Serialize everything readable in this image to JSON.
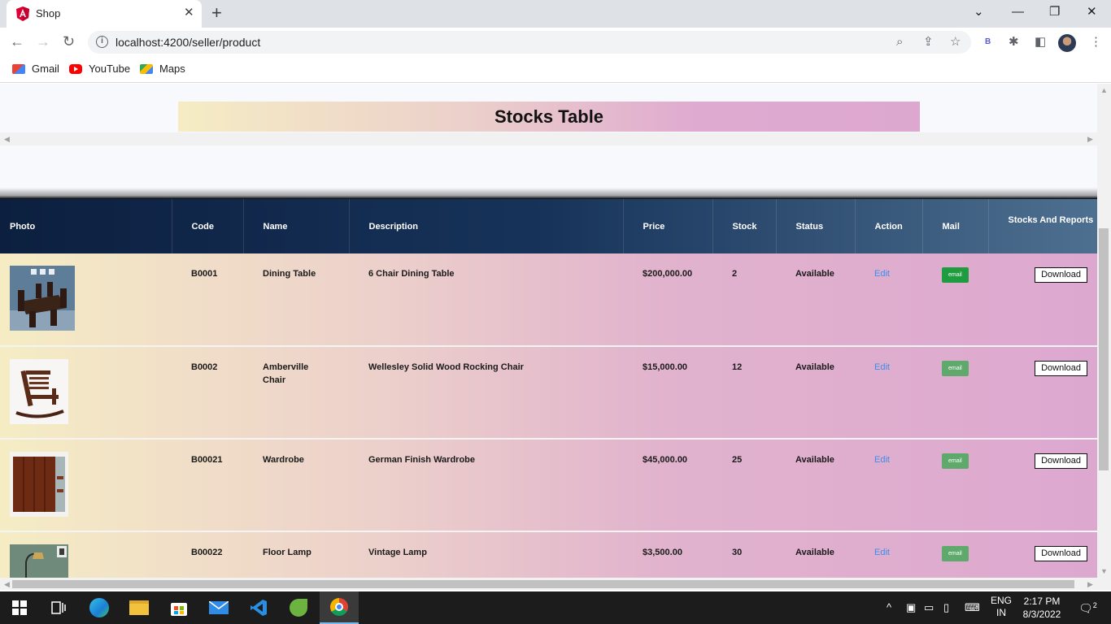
{
  "browser": {
    "tab_title": "Shop",
    "url": "localhost:4200/seller/product",
    "bookmarks": [
      {
        "label": "Gmail"
      },
      {
        "label": "YouTube"
      },
      {
        "label": "Maps"
      }
    ],
    "extension_letter": "B"
  },
  "page": {
    "title": "Stocks Table"
  },
  "table": {
    "headers": {
      "photo": "Photo",
      "code": "Code",
      "name": "Name",
      "description": "Description",
      "price": "Price",
      "stock": "Stock",
      "status": "Status",
      "action": "Action",
      "mail": "Mail",
      "stocks_reports": "Stocks And Reports"
    },
    "rows": [
      {
        "code": "B0001",
        "name": "Dining Table",
        "description": "6 Chair Dining Table",
        "price": "$200,000.00",
        "stock": "2",
        "status": "Available",
        "action": "Edit",
        "mail": "email",
        "download": "Download",
        "photo": "dining-table-photo"
      },
      {
        "code": "B0002",
        "name": "Amberville Chair",
        "description": "Wellesley Solid Wood Rocking Chair",
        "price": "$15,000.00",
        "stock": "12",
        "status": "Available",
        "action": "Edit",
        "mail": "email",
        "download": "Download",
        "photo": "rocking-chair-photo"
      },
      {
        "code": "B00021",
        "name": "Wardrobe",
        "description": "German Finish Wardrobe",
        "price": "$45,000.00",
        "stock": "25",
        "status": "Available",
        "action": "Edit",
        "mail": "email",
        "download": "Download",
        "photo": "wardrobe-photo"
      },
      {
        "code": "B00022",
        "name": "Floor Lamp",
        "description": "Vintage Lamp",
        "price": "$3,500.00",
        "stock": "30",
        "status": "Available",
        "action": "Edit",
        "mail": "email",
        "download": "Download",
        "photo": "floor-lamp-photo"
      }
    ]
  },
  "taskbar": {
    "language_top": "ENG",
    "language_bottom": "IN",
    "time": "2:17 PM",
    "date": "8/3/2022",
    "notifications": "2"
  },
  "colors": {
    "header_dark": "#0c1f3f",
    "header_light": "#4e7090",
    "row_start": "#f5ecc4",
    "row_end": "#dda8d0",
    "email_active": "#1f9c40",
    "email_muted": "#5fa96d",
    "edit_link": "#3b8ee8"
  }
}
